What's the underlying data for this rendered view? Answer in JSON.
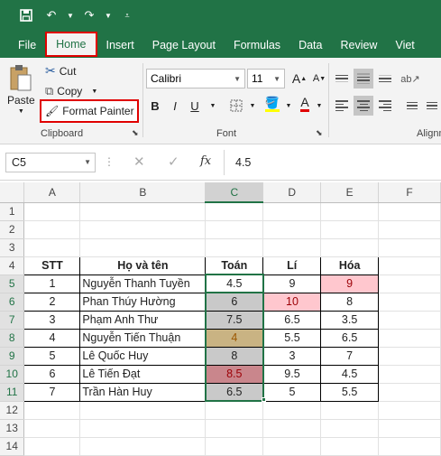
{
  "tabs": [
    "File",
    "Home",
    "Insert",
    "Page Layout",
    "Formulas",
    "Data",
    "Review",
    "Viet"
  ],
  "clipboard": {
    "paste": "Paste",
    "cut": "Cut",
    "copy": "Copy",
    "format_painter": "Format Painter",
    "group": "Clipboard"
  },
  "font": {
    "name": "Calibri",
    "size": "11",
    "bold": "B",
    "italic": "I",
    "underline": "U",
    "group": "Font"
  },
  "alignment": {
    "group": "Alignment"
  },
  "formula_bar": {
    "name_box": "C5",
    "fx": "fx",
    "value": "4.5"
  },
  "columns": [
    "A",
    "B",
    "C",
    "D",
    "E",
    "F"
  ],
  "rows": [
    "1",
    "2",
    "3",
    "4",
    "5",
    "6",
    "7",
    "8",
    "9",
    "10",
    "11",
    "12",
    "13",
    "14"
  ],
  "table": {
    "headers": [
      "STT",
      "Họ và tên",
      "Toán",
      "Lí",
      "Hóa"
    ],
    "data": [
      [
        "1",
        "Nguyễn Thanh Tuyền",
        "4.5",
        "9",
        "9"
      ],
      [
        "2",
        "Phan Thúy Hường",
        "6",
        "10",
        "8"
      ],
      [
        "3",
        "Phạm Anh Thư",
        "7.5",
        "6.5",
        "3.5"
      ],
      [
        "4",
        "Nguyễn Tiến Thuận",
        "4",
        "5.5",
        "6.5"
      ],
      [
        "5",
        "Lê Quốc Huy",
        "8",
        "3",
        "7"
      ],
      [
        "6",
        "Lê Tiến Đạt",
        "8.5",
        "9.5",
        "4.5"
      ],
      [
        "7",
        "Trần Hàn Huy",
        "6.5",
        "5",
        "5.5"
      ]
    ]
  },
  "colors": {
    "excel_green": "#217346",
    "highlight_red": "#e00000",
    "pink_fill": "#ffc7ce",
    "pink_text": "#9c0006",
    "grey_fill": "#c9c9c9",
    "gold_fill": "#c9b383",
    "gold_text": "#9c5700",
    "rose_fill": "#c9868c"
  }
}
